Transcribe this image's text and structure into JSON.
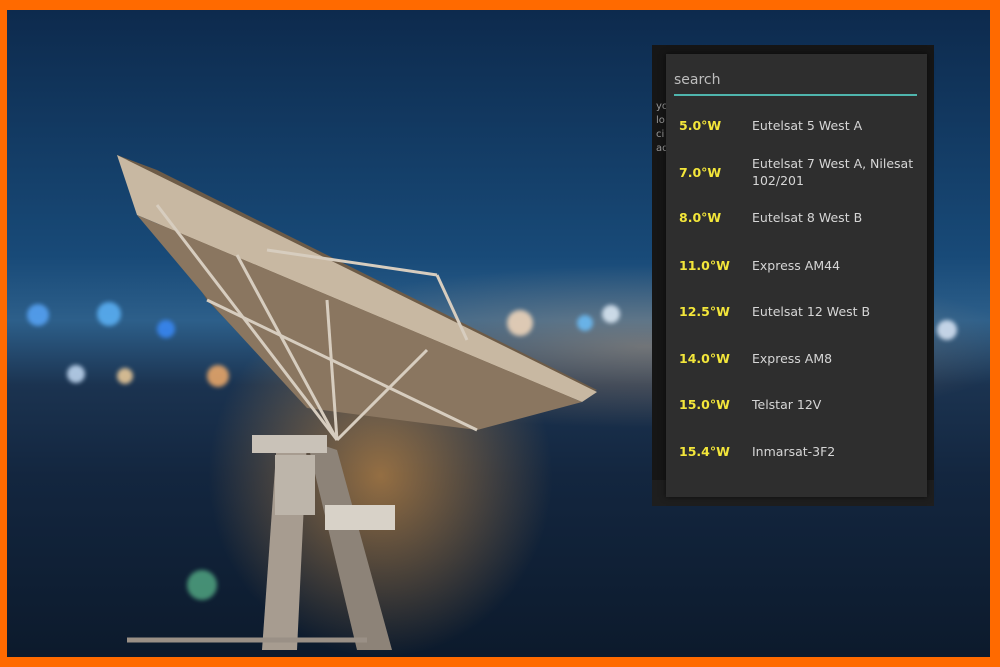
{
  "search": {
    "placeholder": "search"
  },
  "satellites": [
    {
      "position": "5.0°W",
      "name": "Eutelsat 5 West A"
    },
    {
      "position": "7.0°W",
      "name": "Eutelsat 7 West A, Nilesat 102/201"
    },
    {
      "position": "8.0°W",
      "name": "Eutelsat 8 West B"
    },
    {
      "position": "11.0°W",
      "name": "Express AM44"
    },
    {
      "position": "12.5°W",
      "name": "Eutelsat 12 West B"
    },
    {
      "position": "14.0°W",
      "name": "Express AM8"
    },
    {
      "position": "15.0°W",
      "name": "Telstar 12V"
    },
    {
      "position": "15.4°W",
      "name": "Inmarsat-3F2"
    }
  ],
  "colors": {
    "frame": "#ff6a00",
    "position_text": "#f3e63a",
    "search_underline": "#4fb5ad",
    "popup_bg": "#2e2e2e"
  }
}
